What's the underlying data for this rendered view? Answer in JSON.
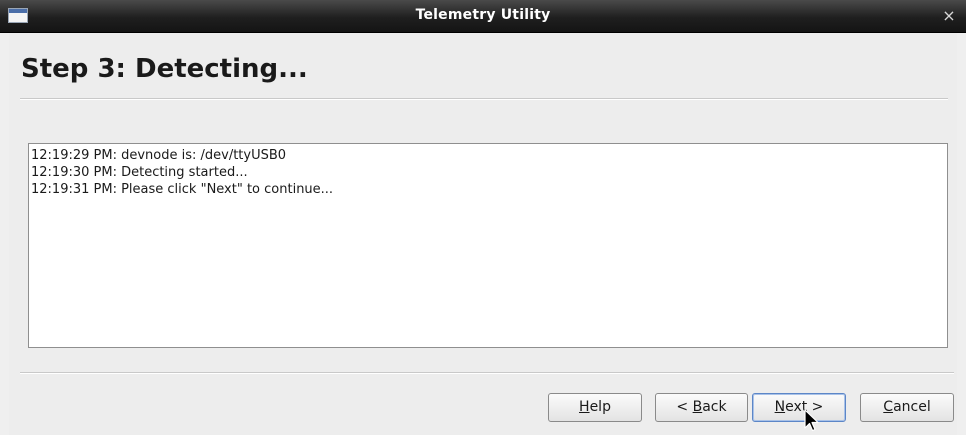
{
  "window": {
    "title": "Telemetry Utility",
    "close_glyph": "×"
  },
  "wizard": {
    "step_title": "Step 3: Detecting..."
  },
  "log": {
    "lines": [
      "12:19:29 PM: devnode is: /dev/ttyUSB0",
      "12:19:30 PM: Detecting started...",
      "12:19:31 PM: Please click \"Next\" to continue..."
    ]
  },
  "buttons": {
    "help": {
      "pre": "",
      "mnemonic": "H",
      "post": "elp"
    },
    "back": {
      "pre": "< ",
      "mnemonic": "B",
      "post": "ack"
    },
    "next": {
      "pre": "",
      "mnemonic": "N",
      "post": "ext >"
    },
    "cancel": {
      "pre": "",
      "mnemonic": "C",
      "post": "ancel"
    }
  },
  "icons": {
    "app": "window-app-icon",
    "close": "close-icon",
    "cursor": "mouse-pointer-icon"
  }
}
